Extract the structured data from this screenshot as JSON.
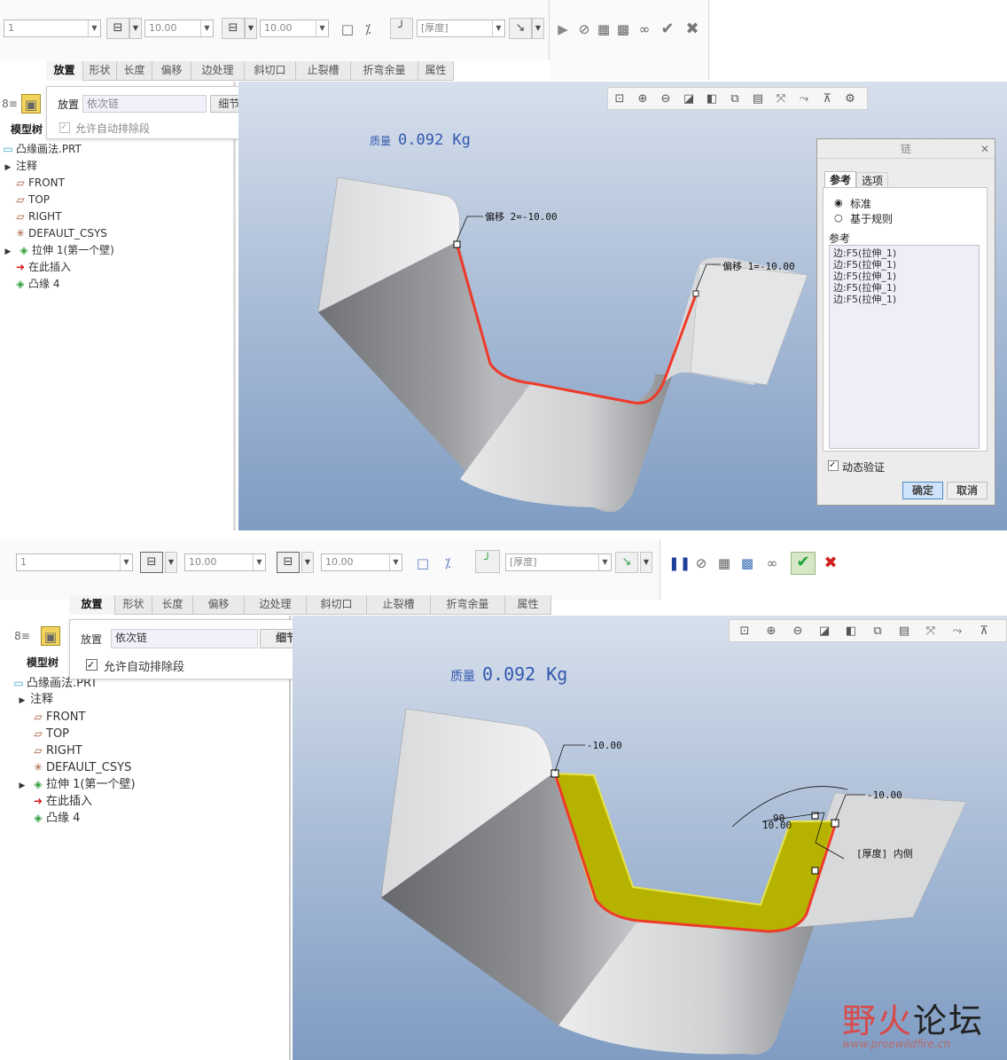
{
  "top": {
    "toolbar": {
      "shape_combo": "1",
      "length_combo1": "10.00",
      "length_combo2": "10.00",
      "thickness_combo": "[厚度]"
    },
    "tabs": [
      "放置",
      "形状",
      "长度",
      "偏移",
      "边处理",
      "斜切口",
      "止裂槽",
      "折弯余量",
      "属性"
    ],
    "placement_popup": {
      "label": "放置",
      "chain_value": "依次链",
      "details_button": "细节...",
      "checkbox_label": "允许自动排除段"
    },
    "model_tree": {
      "tab_label": "模型树",
      "items": [
        "凸缘画法.PRT",
        "注释",
        "FRONT",
        "TOP",
        "RIGHT",
        "DEFAULT_CSYS",
        "拉伸 1(第一个壁)",
        "在此插入",
        "凸缘 4"
      ]
    },
    "mass": {
      "label": "质量",
      "value": "0.092 Kg"
    },
    "dims": [
      "2=-10.00",
      "1=-10.00"
    ],
    "dim_prefix": "偏移",
    "chain_dialog": {
      "title": "链",
      "tabs": [
        "参考",
        "选项"
      ],
      "radio_standard": "标准",
      "radio_rule": "基于规则",
      "ref_label": "参考",
      "refs": [
        "边:F5(拉伸_1)",
        "边:F5(拉伸_1)",
        "边:F5(拉伸_1)",
        "边:F5(拉伸_1)",
        "边:F5(拉伸_1)"
      ],
      "dynamic_check": "动态验证",
      "ok": "确定",
      "cancel": "取消"
    }
  },
  "bottom": {
    "toolbar": {
      "shape_combo": "1",
      "length_combo1": "10.00",
      "length_combo2": "10.00",
      "thickness_combo": "[厚度]"
    },
    "tabs": [
      "放置",
      "形状",
      "长度",
      "偏移",
      "边处理",
      "斜切口",
      "止裂槽",
      "折弯余量",
      "属性"
    ],
    "placement_popup": {
      "label": "放置",
      "chain_value": "依次链",
      "details_button": "细节...",
      "checkbox_label": "允许自动排除段"
    },
    "model_tree": {
      "tab_label": "模型树",
      "items": [
        "凸缘画法.PRT",
        "注释",
        "FRONT",
        "TOP",
        "RIGHT",
        "DEFAULT_CSYS",
        "拉伸 1(第一个壁)",
        "在此插入",
        "凸缘 4"
      ]
    },
    "mass": {
      "label": "质量",
      "value": "0.092 Kg"
    },
    "dims": [
      "-10.00",
      "-10.00",
      "90",
      "10.00",
      "[厚度] 内侧"
    ]
  },
  "watermark": {
    "cn_red": "野火",
    "cn_dark": "论坛",
    "url": "www.proewildfire.cn"
  },
  "colors": {
    "accent_red": "#e8392b",
    "flange_yellow": "#b6b300",
    "mass_blue": "#3358b0",
    "ok_green": "#1fa33a",
    "cancel_red": "#d12020"
  }
}
